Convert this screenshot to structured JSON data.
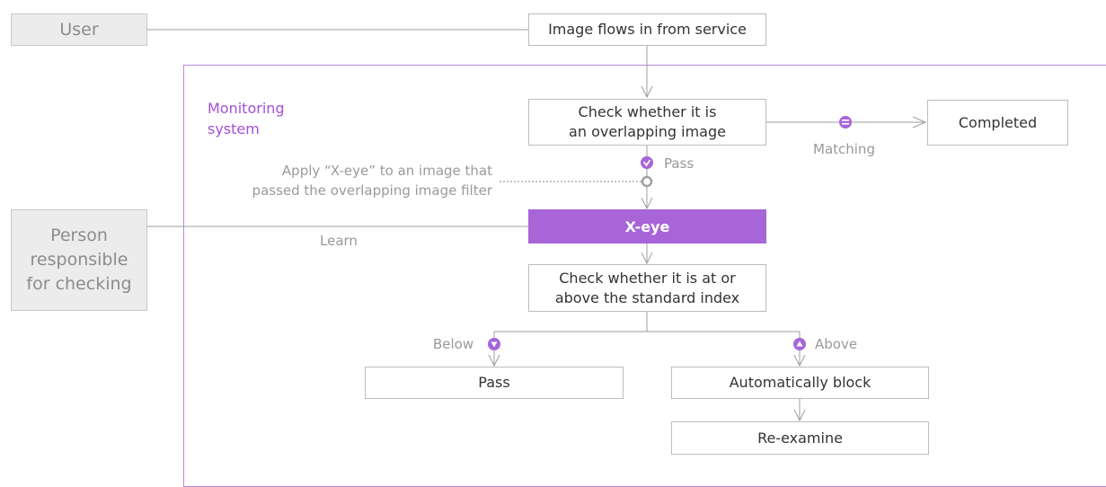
{
  "actors": {
    "user": "User",
    "person_line1": "Person",
    "person_line2": "responsible",
    "person_line3": "for checking"
  },
  "system": {
    "title_line1": "Monitoring",
    "title_line2": "system"
  },
  "steps": {
    "image_flows": "Image flows in from service",
    "check_overlap_line1": "Check whether it is",
    "check_overlap_line2": "an overlapping image",
    "completed": "Completed",
    "xeye": "X-eye",
    "check_index_line1": "Check whether it is at or",
    "check_index_line2": "above the standard index",
    "pass_box": "Pass",
    "auto_block": "Automatically block",
    "re_examine": "Re-examine"
  },
  "edge_labels": {
    "matching": "Matching",
    "pass": "Pass",
    "learn": "Learn",
    "below": "Below",
    "above": "Above"
  },
  "note": {
    "line1": "Apply “X-eye” to an image that",
    "line2": "passed the overlapping image filter"
  },
  "colors": {
    "accent": "#a765d8",
    "frame": "#b98ae0",
    "box_border": "#bdbdbd",
    "actor_fill": "#ececec"
  }
}
